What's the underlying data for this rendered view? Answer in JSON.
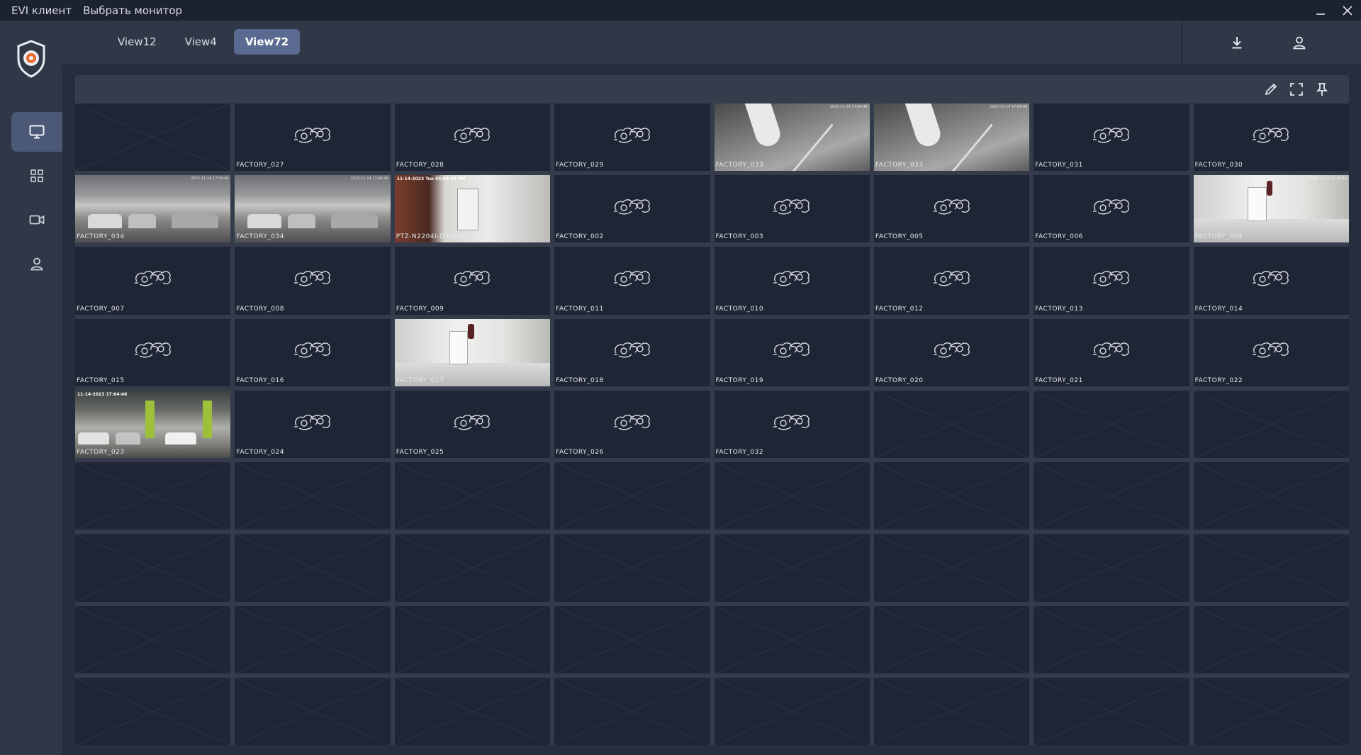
{
  "titlebar": {
    "app_name": "EVI клиент",
    "menu_select_monitor": "Выбрать монитор"
  },
  "sidebar": {
    "items": [
      {
        "name": "monitor",
        "icon": "monitor-icon",
        "active": true
      },
      {
        "name": "layouts",
        "icon": "grid-icon",
        "active": false
      },
      {
        "name": "cameras",
        "icon": "video-camera-icon",
        "active": false
      },
      {
        "name": "users",
        "icon": "user-icon",
        "active": false
      }
    ]
  },
  "tabs": [
    {
      "label": "View12",
      "active": false
    },
    {
      "label": "View4",
      "active": false
    },
    {
      "label": "View72",
      "active": true
    }
  ],
  "toolbar": {
    "icons": [
      "pencil-icon",
      "fullscreen-icon",
      "pin-icon"
    ]
  },
  "colors": {
    "accent": "#5b6a90",
    "background": "#262d3d",
    "cell": "#1f2535"
  },
  "grid": {
    "columns": 8,
    "rows": 9,
    "cells": [
      {
        "label": "",
        "type": "empty"
      },
      {
        "label": "FACTORY_027",
        "type": "no-signal"
      },
      {
        "label": "FACTORY_028",
        "type": "no-signal"
      },
      {
        "label": "FACTORY_029",
        "type": "no-signal"
      },
      {
        "label": "FACTORY_033",
        "type": "feed",
        "feed": "pipe",
        "timestamp": "2023-11-14 17:04:46"
      },
      {
        "label": "FACTORY_033",
        "type": "feed",
        "feed": "pipe",
        "timestamp": "2023-11-14 17:04:46"
      },
      {
        "label": "FACTORY_031",
        "type": "no-signal"
      },
      {
        "label": "FACTORY_030",
        "type": "no-signal"
      },
      {
        "label": "FACTORY_034",
        "type": "feed",
        "feed": "garage",
        "timestamp": "2023-11-14 17:04:46"
      },
      {
        "label": "FACTORY_034",
        "type": "feed",
        "feed": "garage",
        "timestamp": "2023-11-14 17:04:46"
      },
      {
        "label": "PTZ-N2204I-D3/W(B)",
        "type": "feed",
        "feed": "room",
        "timestamp": "11-14-2023 Tue 05:04:46 PM"
      },
      {
        "label": "FACTORY_002",
        "type": "no-signal"
      },
      {
        "label": "FACTORY_003",
        "type": "no-signal"
      },
      {
        "label": "FACTORY_005",
        "type": "no-signal"
      },
      {
        "label": "FACTORY_006",
        "type": "no-signal"
      },
      {
        "label": "FACTORY_004",
        "type": "feed",
        "feed": "hall",
        "timestamp": "2023-11-14 17:04:46"
      },
      {
        "label": "FACTORY_007",
        "type": "no-signal"
      },
      {
        "label": "FACTORY_008",
        "type": "no-signal"
      },
      {
        "label": "FACTORY_009",
        "type": "no-signal"
      },
      {
        "label": "FACTORY_011",
        "type": "no-signal"
      },
      {
        "label": "FACTORY_010",
        "type": "no-signal"
      },
      {
        "label": "FACTORY_012",
        "type": "no-signal"
      },
      {
        "label": "FACTORY_013",
        "type": "no-signal"
      },
      {
        "label": "FACTORY_014",
        "type": "no-signal"
      },
      {
        "label": "FACTORY_015",
        "type": "no-signal"
      },
      {
        "label": "FACTORY_016",
        "type": "no-signal"
      },
      {
        "label": "FACTORY_017",
        "type": "feed",
        "feed": "hall2"
      },
      {
        "label": "FACTORY_018",
        "type": "no-signal"
      },
      {
        "label": "FACTORY_019",
        "type": "no-signal"
      },
      {
        "label": "FACTORY_020",
        "type": "no-signal"
      },
      {
        "label": "FACTORY_021",
        "type": "no-signal"
      },
      {
        "label": "FACTORY_022",
        "type": "no-signal"
      },
      {
        "label": "FACTORY_023",
        "type": "feed",
        "feed": "park2",
        "timestamp": "11-14-2023 17:04:46"
      },
      {
        "label": "FACTORY_024",
        "type": "no-signal"
      },
      {
        "label": "FACTORY_025",
        "type": "no-signal"
      },
      {
        "label": "FACTORY_026",
        "type": "no-signal"
      },
      {
        "label": "FACTORY_032",
        "type": "no-signal"
      },
      {
        "label": "",
        "type": "empty"
      },
      {
        "label": "",
        "type": "empty"
      },
      {
        "label": "",
        "type": "empty"
      }
    ]
  }
}
